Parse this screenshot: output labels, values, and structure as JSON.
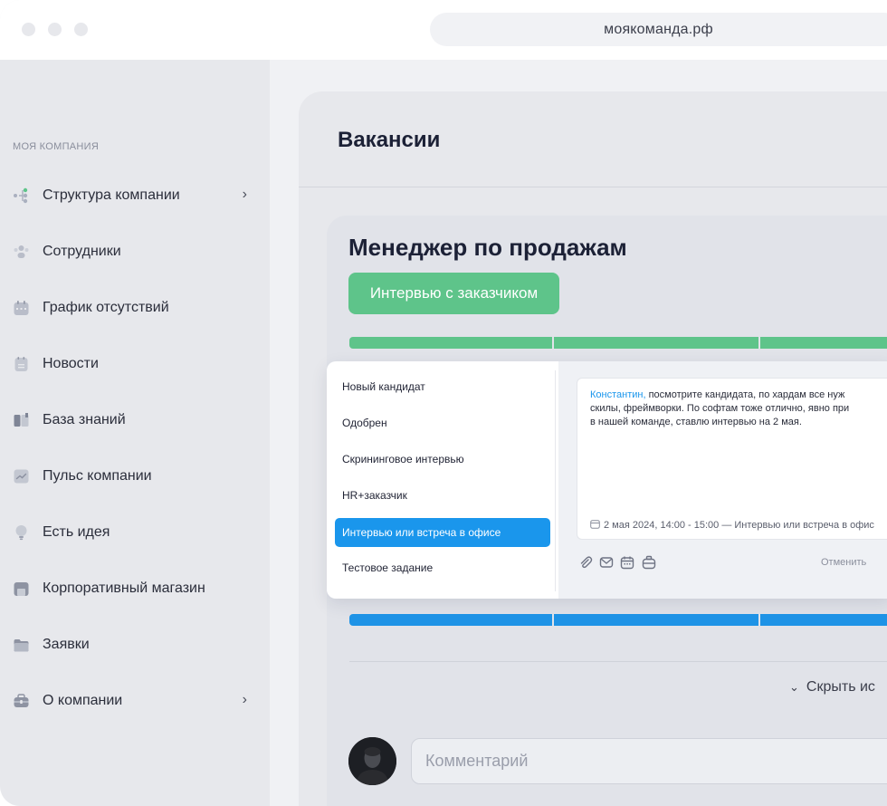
{
  "browser": {
    "url": "моякоманда.рф"
  },
  "sidebar": {
    "section_label": "МОЯ КОМПАНИЯ",
    "items": [
      {
        "label": "Структура компании",
        "icon": "org-structure-icon",
        "has_chevron": true
      },
      {
        "label": "Сотрудники",
        "icon": "employees-icon",
        "has_chevron": false
      },
      {
        "label": "График отсутствий",
        "icon": "calendar-icon",
        "has_chevron": false
      },
      {
        "label": "Новости",
        "icon": "news-icon",
        "has_chevron": false
      },
      {
        "label": "База знаний",
        "icon": "book-icon",
        "has_chevron": false
      },
      {
        "label": "Пульс компании",
        "icon": "pulse-icon",
        "has_chevron": false
      },
      {
        "label": "Есть идея",
        "icon": "lightbulb-icon",
        "has_chevron": false
      },
      {
        "label": "Корпоративный магазин",
        "icon": "shop-icon",
        "has_chevron": false
      },
      {
        "label": "Заявки",
        "icon": "folder-icon",
        "has_chevron": false
      },
      {
        "label": "О компании",
        "icon": "briefcase-icon",
        "has_chevron": true
      }
    ]
  },
  "main": {
    "title": "Вакансии",
    "vacancy": {
      "title": "Менеджер по продажам",
      "stage_badge": "Интервью с заказчиком"
    },
    "stage_menu": {
      "items": [
        "Новый кандидат",
        "Одобрен",
        "Скрининговое интервью",
        "HR+заказчик",
        "Интервью или встреча в офисе",
        "Тестовое задание"
      ],
      "active_index": 4
    },
    "note": {
      "mention": "Константин,",
      "line1_rest": " посмотрите кандидата, по хардам все нуж",
      "line2": "скилы, фреймворки. По софтам тоже отлично, явно при",
      "line3": "в нашей команде, ставлю интервью на 2 мая.",
      "event": "2 мая 2024, 14:00 - 15:00 — Интервью или встреча в офис"
    },
    "tools": [
      "paperclip-icon",
      "mail-icon",
      "calendar-icon",
      "briefcase-icon"
    ],
    "cancel_label": "Отменить",
    "hide_toggle": "Скрыть ис",
    "comment_placeholder": "Комментарий"
  },
  "colors": {
    "accent_green": "#5ec48a",
    "accent_blue": "#1e93e6",
    "active_item": "#1a96ec"
  }
}
